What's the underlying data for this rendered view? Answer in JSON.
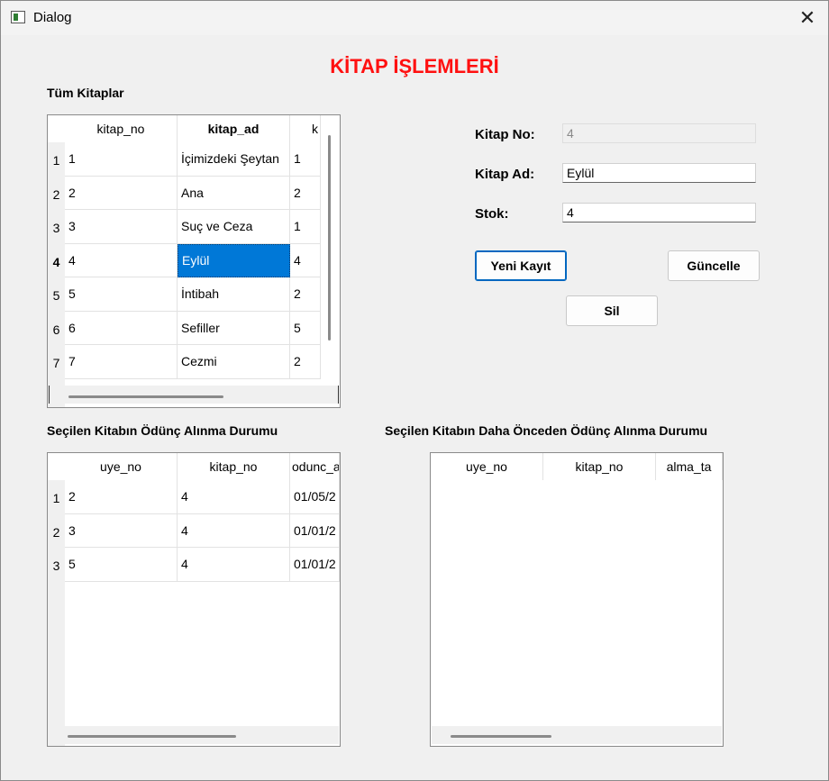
{
  "window": {
    "title": "Dialog",
    "close_glyph": "✕"
  },
  "header": {
    "title": "KİTAP İŞLEMLERİ"
  },
  "books": {
    "label": "Tüm Kitaplar",
    "columns": [
      "kitap_no",
      "kitap_ad",
      "k"
    ],
    "rows": [
      {
        "n": "1",
        "c": [
          "1",
          "İçimizdeki Şeytan",
          "1"
        ]
      },
      {
        "n": "2",
        "c": [
          "2",
          "Ana",
          "2"
        ]
      },
      {
        "n": "3",
        "c": [
          "3",
          "Suç ve Ceza",
          "1"
        ]
      },
      {
        "n": "4",
        "c": [
          "4",
          "Eylül",
          "4"
        ]
      },
      {
        "n": "5",
        "c": [
          "5",
          "İntibah",
          "2"
        ]
      },
      {
        "n": "6",
        "c": [
          "6",
          "Sefiller",
          "5"
        ]
      },
      {
        "n": "7",
        "c": [
          "7",
          "Cezmi",
          "2"
        ]
      }
    ],
    "selected_row": 4,
    "selected_col": 1
  },
  "form": {
    "kitap_no_label": "Kitap No:",
    "kitap_no_value": "4",
    "kitap_ad_label": "Kitap Ad:",
    "kitap_ad_value": "Eylül",
    "stok_label": "Stok:",
    "stok_value": "4",
    "new_button": "Yeni Kayıt",
    "update_button": "Güncelle",
    "delete_button": "Sil"
  },
  "current_loans": {
    "label": "Seçilen Kitabın Ödünç Alınma Durumu",
    "columns": [
      "uye_no",
      "kitap_no",
      "odunc_a"
    ],
    "rows": [
      {
        "n": "1",
        "c": [
          "2",
          "4",
          "01/05/2"
        ]
      },
      {
        "n": "2",
        "c": [
          "3",
          "4",
          "01/01/2"
        ]
      },
      {
        "n": "3",
        "c": [
          "5",
          "4",
          "01/01/2"
        ]
      }
    ]
  },
  "past_loans": {
    "label": "Seçilen Kitabın Daha Önceden Ödünç Alınma Durumu",
    "columns": [
      "uye_no",
      "kitap_no",
      "alma_ta"
    ],
    "rows": []
  }
}
